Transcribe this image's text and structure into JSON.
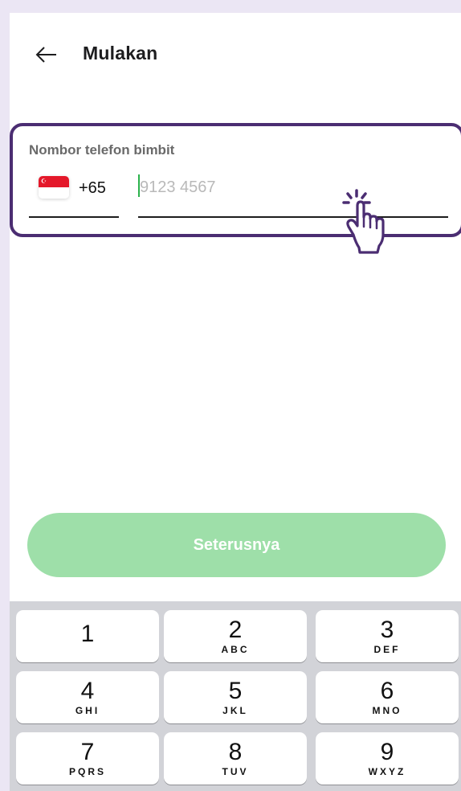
{
  "header": {
    "title": "Mulakan",
    "back_icon": "arrow-left-icon"
  },
  "phone_field": {
    "label": "Nombor telefon bimbit",
    "country_flag": "singapore-flag-icon",
    "dial_code": "+65",
    "placeholder": "9123 4567",
    "value": ""
  },
  "pointer": {
    "icon": "hand-pointer-click-icon"
  },
  "continue_button": {
    "label": "Seterusnya",
    "color": "#9edfa9"
  },
  "keypad": {
    "keys": [
      {
        "digit": "1",
        "letters": ""
      },
      {
        "digit": "2",
        "letters": "ABC"
      },
      {
        "digit": "3",
        "letters": "DEF"
      },
      {
        "digit": "4",
        "letters": "GHI"
      },
      {
        "digit": "5",
        "letters": "JKL"
      },
      {
        "digit": "6",
        "letters": "MNO"
      },
      {
        "digit": "7",
        "letters": "PQRS"
      },
      {
        "digit": "8",
        "letters": "TUV"
      },
      {
        "digit": "9",
        "letters": "WXYZ"
      }
    ]
  },
  "colors": {
    "accent_border": "#4b2d72",
    "caret": "#2bb24c",
    "background": "#ebe6f4"
  }
}
